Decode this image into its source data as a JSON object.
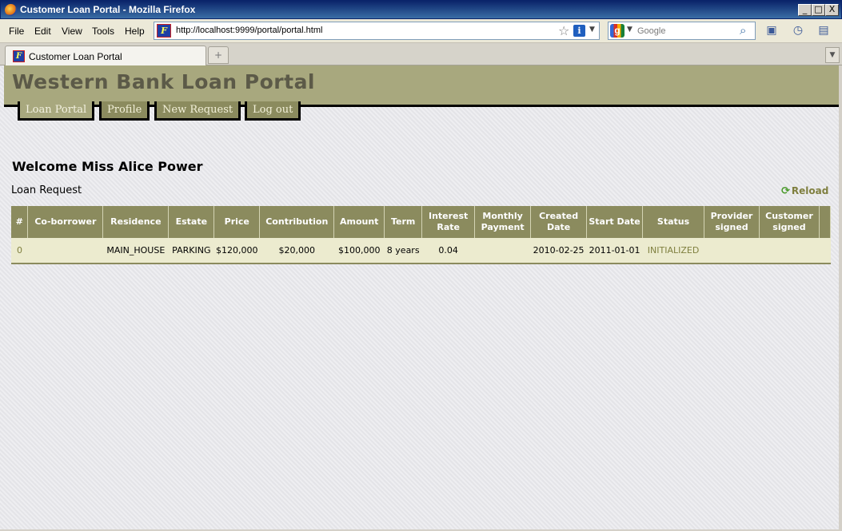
{
  "window": {
    "title": "Customer Loan Portal - Mozilla Firefox",
    "controls": {
      "minimize": "_",
      "maximize": "□",
      "close": "X"
    }
  },
  "menu": [
    "File",
    "Edit",
    "View",
    "Tools",
    "Help"
  ],
  "address_bar": {
    "url": "http://localhost:9999/portal/portal.html",
    "site_icon_text": "F"
  },
  "search_bar": {
    "engine_icon_text": "g",
    "placeholder": "Google"
  },
  "tabs": [
    {
      "label": "Customer Loan Portal",
      "active": true
    }
  ],
  "page": {
    "site_title": "Western Bank Loan Portal",
    "nav": [
      "Loan Portal",
      "Profile",
      "New Request",
      "Log out"
    ],
    "active_nav": "Loan Portal",
    "welcome": "Welcome Miss Alice Power",
    "section_title": "Loan Request",
    "reload_label": "Reload",
    "table": {
      "columns": [
        "#",
        "Co-borrower",
        "Residence",
        "Estate",
        "Price",
        "Contribution",
        "Amount",
        "Term",
        "Interest Rate",
        "Monthly Payment",
        "Created Date",
        "Start Date",
        "Status",
        "Provider signed",
        "Customer signed",
        ""
      ],
      "rows": [
        [
          "0",
          "",
          "MAIN_HOUSE",
          "PARKING",
          "$120,000",
          "$20,000",
          "$100,000",
          "8 years",
          "0.04",
          "",
          "2010-02-25",
          "2011-01-01",
          "INITIALIZED",
          "",
          "",
          ""
        ]
      ]
    }
  },
  "colors": {
    "header_bg": "#a8a87e",
    "nav_bg": "#8b8b5e",
    "row_bg": "#ecebcf",
    "accent_text": "#7f7f3f"
  }
}
